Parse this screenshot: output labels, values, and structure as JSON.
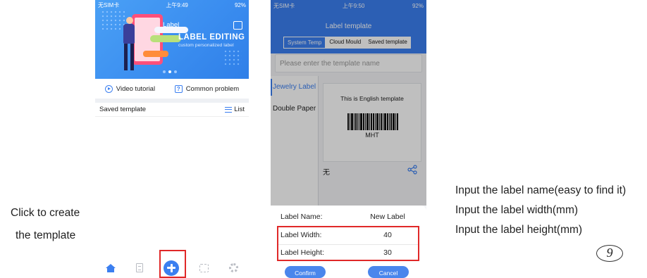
{
  "left_caption": {
    "line1": "Click to create",
    "line2": "the template"
  },
  "phone1": {
    "status": {
      "carrier": "无SIM卡",
      "time": "上午9:49",
      "battery": "92%"
    },
    "banner": {
      "app_name": "Label",
      "headline": "LABEL EDITING",
      "subline": "custom personalized label"
    },
    "help_links": {
      "video": "Video tutorial",
      "faq": "Common problem"
    },
    "saved": {
      "title": "Saved template",
      "list_label": "List"
    },
    "tabbar": [
      "home-icon",
      "document-icon",
      "add-icon",
      "scan-icon",
      "gear-icon"
    ]
  },
  "phone2": {
    "status": {
      "carrier": "无SIM卡",
      "time": "上午9:50",
      "battery": "92%"
    },
    "title": "Label template",
    "tabs": [
      "System Temp",
      "Cloud Mould",
      "Saved template"
    ],
    "search_placeholder": "Please enter the template name",
    "sidebar": [
      "Jewelry Label",
      "Double Paper"
    ],
    "card": {
      "text": "This is English template",
      "barcode_text": "MHT",
      "footer": "无"
    },
    "modal": {
      "name_label": "Label Name:",
      "name_value": "New Label",
      "width_label": "Label Width:",
      "width_value": "40",
      "height_label": "Label Height:",
      "height_value": "30",
      "confirm": "Confirm",
      "cancel": "Cancel"
    }
  },
  "right_notes": {
    "line1": "Input the label name(easy to find it)",
    "line2": "Input the label width(mm)",
    "line3": "Input the label height(mm)"
  },
  "page_number": "9",
  "colors": {
    "accent": "#3b7ff0",
    "highlight": "#e02828"
  }
}
